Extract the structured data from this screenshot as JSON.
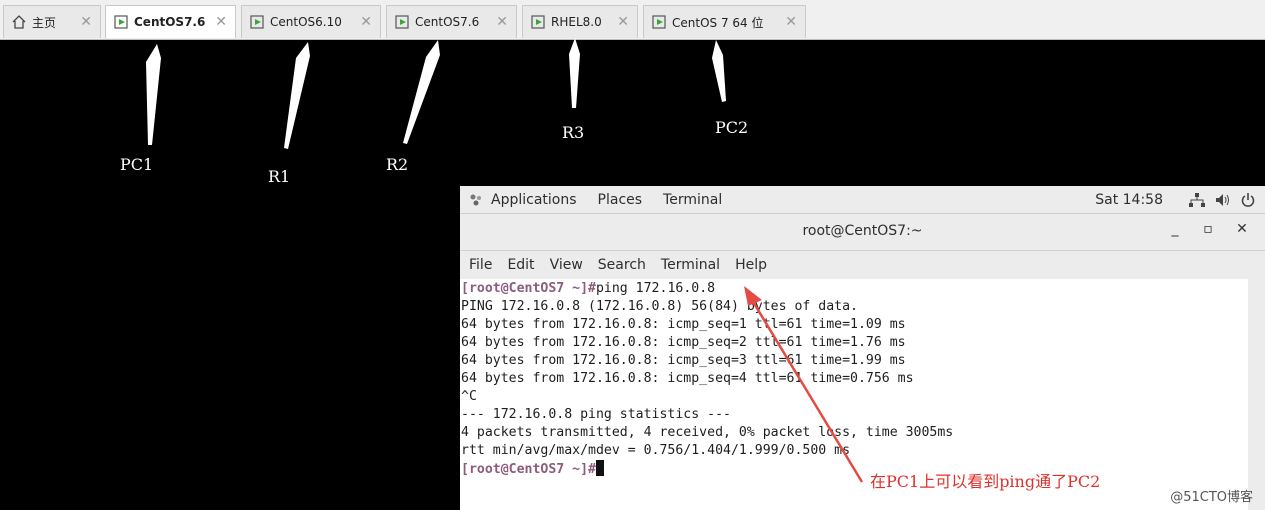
{
  "tabs": [
    {
      "label": "主页",
      "icon": "home-icon"
    },
    {
      "label": "CentOS7.6",
      "icon": "vm-play-icon"
    },
    {
      "label": "CentOS6.10",
      "icon": "vm-play-icon"
    },
    {
      "label": "CentOS7.6",
      "icon": "vm-play-icon"
    },
    {
      "label": "RHEL8.0",
      "icon": "vm-play-icon"
    },
    {
      "label": "CentOS 7 64 位",
      "icon": "vm-play-icon"
    }
  ],
  "annotations": [
    "PC1",
    "R1",
    "R2",
    "R3",
    "PC2"
  ],
  "gnome_bar": {
    "applications": "Applications",
    "places": "Places",
    "terminal": "Terminal",
    "clock": "Sat 14:58"
  },
  "window": {
    "title": "root@CentOS7:~"
  },
  "menu": [
    "File",
    "Edit",
    "View",
    "Search",
    "Terminal",
    "Help"
  ],
  "terminal": {
    "prompt": "[root@CentOS7 ~]#",
    "command": "ping 172.16.0.8",
    "lines": [
      "PING 172.16.0.8 (172.16.0.8) 56(84) bytes of data.",
      "64 bytes from 172.16.0.8: icmp_seq=1 ttl=61 time=1.09 ms",
      "64 bytes from 172.16.0.8: icmp_seq=2 ttl=61 time=1.76 ms",
      "64 bytes from 172.16.0.8: icmp_seq=3 ttl=61 time=1.99 ms",
      "64 bytes from 172.16.0.8: icmp_seq=4 ttl=61 time=0.756 ms",
      "^C",
      "--- 172.16.0.8 ping statistics ---",
      "4 packets transmitted, 4 received, 0% packet loss, time 3005ms",
      "rtt min/avg/max/mdev = 0.756/1.404/1.999/0.500 ms"
    ],
    "final_prompt": "[root@CentOS7 ~]#"
  },
  "note": "在PC1上可以看到ping通了PC2",
  "watermark": "@51CTO博客",
  "colors": {
    "prompt": "#8d5b7d",
    "note": "#e0302c",
    "arrow": "#e34b43"
  }
}
